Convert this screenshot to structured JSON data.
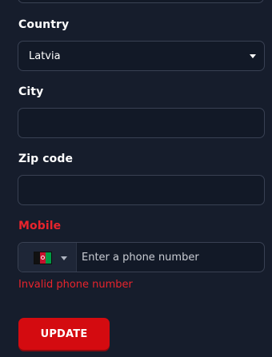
{
  "form": {
    "country": {
      "label": "Country",
      "value": "Latvia"
    },
    "city": {
      "label": "City",
      "value": ""
    },
    "zip": {
      "label": "Zip code",
      "value": ""
    },
    "mobile": {
      "label": "Mobile",
      "placeholder": "Enter a phone number",
      "flag_icon": "afghanistan-flag-icon",
      "error": "Invalid phone number"
    },
    "update_label": "UPDATE"
  },
  "colors": {
    "background": "#161d2c",
    "field_background": "#121927",
    "error": "#e8242c",
    "button": "#d40b10"
  }
}
